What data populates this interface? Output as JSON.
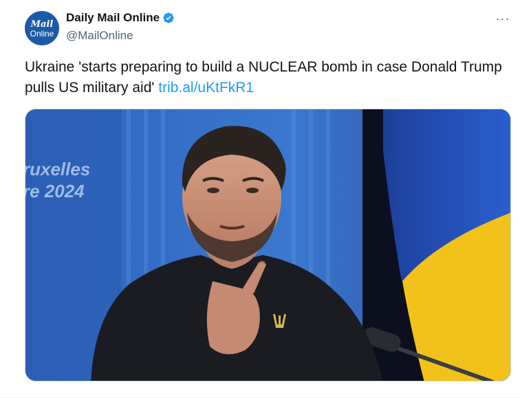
{
  "account": {
    "avatar_line1": "Mail",
    "avatar_line2": "Online",
    "display_name": "Daily Mail Online",
    "handle": "@MailOnline",
    "verified": true
  },
  "tweet": {
    "text": "Ukraine 'starts preparing to build a NUCLEAR bomb in case Donald Trump pulls US military aid' ",
    "link": "trib.al/uKtFkR1"
  },
  "more_menu": {
    "icon": "more-dots-icon",
    "label": "···"
  },
  "media": {
    "backdrop_text_line1": "ruxelles",
    "backdrop_text_line2": "re 2024"
  },
  "colors": {
    "link": "#1d9bf0",
    "verified": "#1d9bf0",
    "backdrop_blue": "#2a5fb5",
    "flag_blue": "#1f4fbf",
    "flag_yellow": "#f5c518",
    "sweater": "#16181c"
  }
}
